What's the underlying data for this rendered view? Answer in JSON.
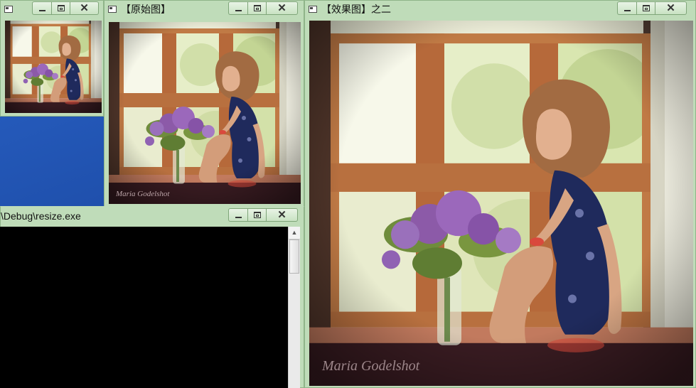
{
  "windows": {
    "thumbnail": {
      "title": "",
      "close_glyph": "✕"
    },
    "original": {
      "title": "【原始图】",
      "close_glyph": "✕"
    },
    "effect": {
      "title": "【效果图】之二",
      "close_glyph": "✕"
    },
    "console": {
      "title": "\\Debug\\resize.exe",
      "close_glyph": "✕"
    }
  },
  "photo": {
    "watermark": "Maria Godelshot"
  },
  "scrollbar": {
    "up_glyph": "▲"
  },
  "icons": {
    "system_menu": "window-icon",
    "minimize": "minimize-icon",
    "maximize": "maximize-icon",
    "close": "close-icon"
  },
  "colors": {
    "window_frame": "#bfdcb9",
    "desktop": "#1d4fa8",
    "console_bg": "#000000"
  }
}
